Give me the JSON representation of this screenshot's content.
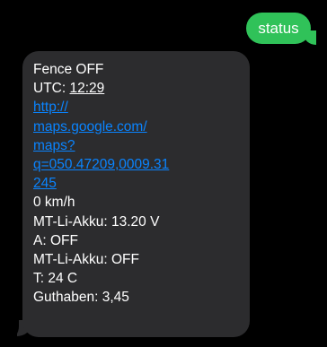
{
  "thread": {
    "outgoing": {
      "text": "status"
    },
    "incoming": {
      "line1": "Fence OFF",
      "utc_label": "UTC: ",
      "utc_time": "12:29",
      "link_lines": [
        "http://",
        "maps.google.com/",
        "maps?",
        "q=050.47209,0009.31",
        "245"
      ],
      "speed": "0 km/h",
      "battery1": "MT-Li-Akku: 13.20 V",
      "a_status": "A: OFF",
      "battery2": "MT-Li-Akku: OFF",
      "temperature": "T: 24 C",
      "credit": "Guthaben: 3,45"
    }
  },
  "colors": {
    "background": "#000000",
    "outgoing_bubble": "#30c259",
    "incoming_bubble": "#2c2c2e",
    "link": "#0a84ff",
    "text": "#ffffff"
  }
}
